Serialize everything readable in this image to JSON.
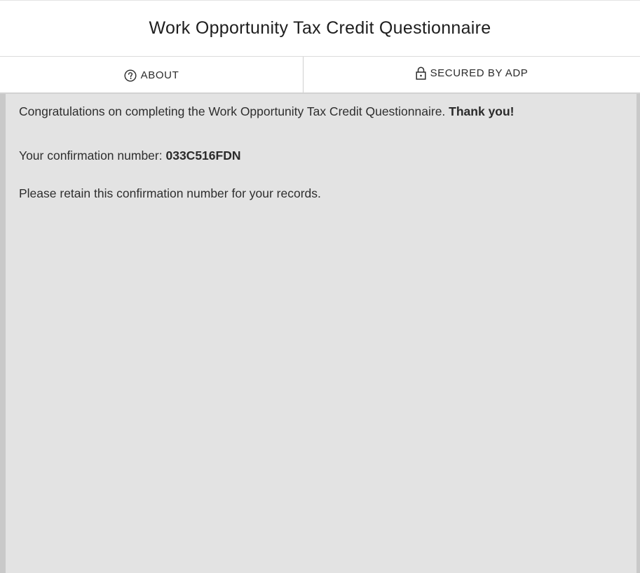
{
  "header": {
    "title": "Work Opportunity Tax Credit Questionnaire"
  },
  "tabs": {
    "about": {
      "label": "ABOUT",
      "icon": "question-circle-icon"
    },
    "secured": {
      "label": "SECURED BY ADP",
      "icon": "lock-icon"
    }
  },
  "content": {
    "congrats_text": "Congratulations on completing the Work Opportunity Tax Credit Questionnaire.",
    "thank_you": "Thank you!",
    "confirmation_label": "Your confirmation number:",
    "confirmation_number": "033C516FDN",
    "retain_text": "Please retain this confirmation number for your records."
  },
  "colors": {
    "content_bg": "#e3e3e3",
    "border": "#d2d2d2",
    "text": "#2e2e2e"
  }
}
